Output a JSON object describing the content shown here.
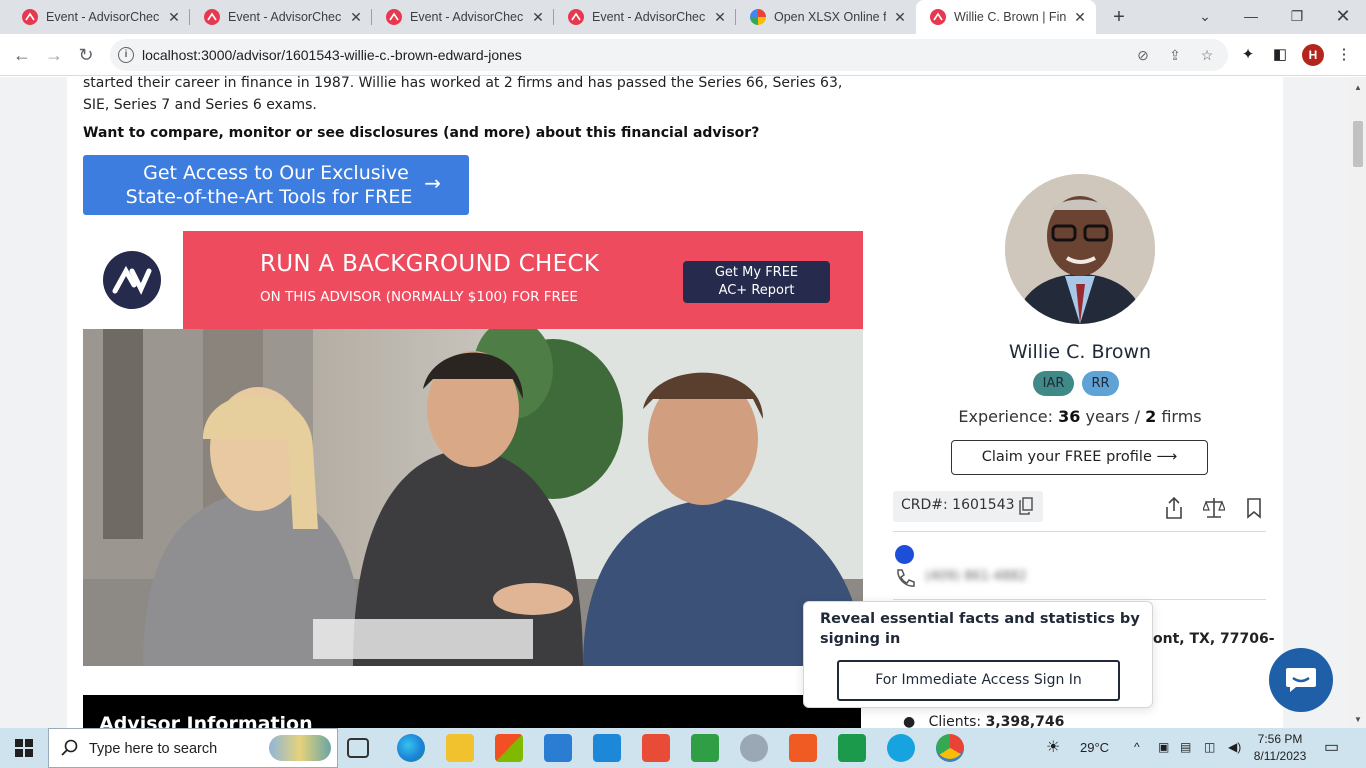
{
  "browser": {
    "tabs": [
      {
        "title": "Event - AdvisorCheck",
        "favicon": "advisorcheck-icon",
        "active": false
      },
      {
        "title": "Event - AdvisorCheck",
        "favicon": "advisorcheck-icon",
        "active": false
      },
      {
        "title": "Event - AdvisorCheck",
        "favicon": "advisorcheck-icon",
        "active": false
      },
      {
        "title": "Event - AdvisorCheck",
        "favicon": "advisorcheck-icon",
        "active": false
      },
      {
        "title": "Open XLSX Online for",
        "favicon": "google-icon",
        "active": false
      },
      {
        "title": "Willie C. Brown | Finan",
        "favicon": "advisorcheck-icon",
        "active": true
      }
    ],
    "url": "localhost:3000/advisor/1601543-willie-c.-brown-edward-jones",
    "profile_initial": "H"
  },
  "page": {
    "bio_text": "started their career in finance in 1987. Willie has worked at 2 firms and has passed the Series 66, Series 63, SIE, Series 7 and Series 6 exams.",
    "question": "Want to compare, monitor or see disclosures (and more) about this financial advisor?",
    "cta": {
      "line1": "Get Access to Our Exclusive",
      "line2": "State-of-the-Art Tools for FREE",
      "arrow": "→"
    },
    "banner": {
      "headline": "RUN A BACKGROUND CHECK",
      "subline": "ON THIS ADVISOR (NORMALLY $100) FOR FREE",
      "button_line1": "Get My FREE",
      "button_line2": "AC+ Report"
    },
    "section_title": "Advisor Information"
  },
  "profile": {
    "name": "Willie C. Brown",
    "badges": [
      {
        "label": "IAR",
        "color": "#3f8a86"
      },
      {
        "label": "RR",
        "color": "#5fa2d6"
      }
    ],
    "experience_label": "Experience:",
    "experience_years": "36",
    "years_word": "years /",
    "experience_firms": "2",
    "firms_word": "firms",
    "claim_button": "Claim your FREE profile",
    "crd": "CRD#: 1601543",
    "phone_blurred": "(409) 861-4882",
    "address_partial": "ont, TX, 77706-",
    "clients_label": "Clients:",
    "clients_value": "3,398,746"
  },
  "signin_popup": {
    "text": "Reveal essential facts and statistics by signing in",
    "button": "For Immediate Access Sign In"
  },
  "taskbar": {
    "search_placeholder": "Type here to search",
    "temperature": "29°C",
    "time": "7:56 PM",
    "date": "8/11/2023"
  },
  "colors": {
    "accent_blue": "#3e7de0",
    "banner_red": "#ef4b5f",
    "navy": "#262b4d"
  }
}
